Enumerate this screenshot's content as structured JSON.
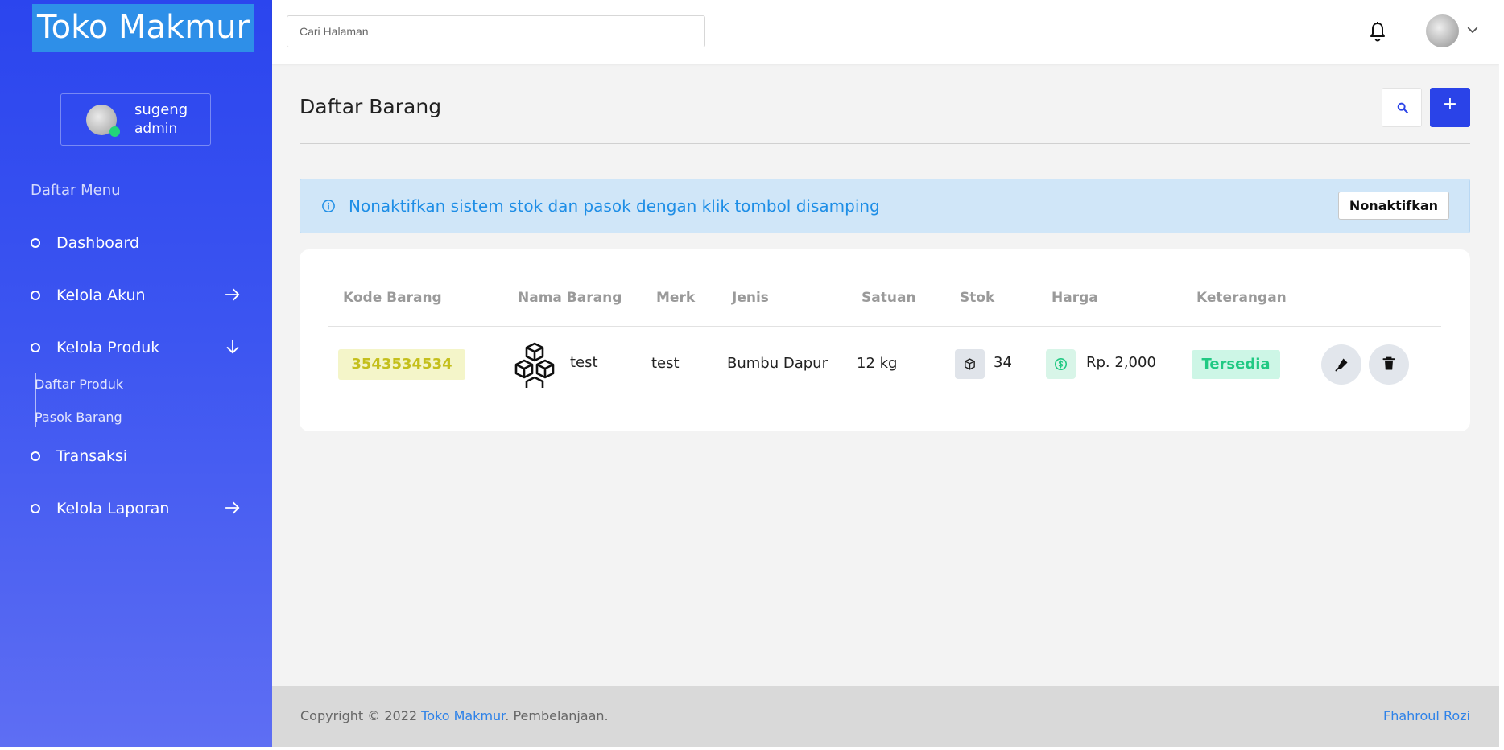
{
  "sidebar": {
    "brand": "Toko Makmur",
    "user": {
      "name": "sugeng",
      "role": "admin"
    },
    "menu_heading": "Daftar Menu",
    "items": [
      {
        "label": "Dashboard",
        "icon": "circle-icon"
      },
      {
        "label": "Kelola Akun",
        "icon": "arrow-right-icon"
      },
      {
        "label": "Kelola Produk",
        "icon": "arrow-down-icon"
      },
      {
        "label": "Transaksi",
        "icon": "circle-icon"
      },
      {
        "label": "Kelola Laporan",
        "icon": "arrow-right-icon"
      }
    ],
    "subitems": [
      {
        "label": "Daftar Produk"
      },
      {
        "label": "Pasok Barang"
      }
    ]
  },
  "header": {
    "search_placeholder": "Cari Halaman"
  },
  "main": {
    "title": "Daftar Barang",
    "add_label": "+",
    "alert": {
      "text": "Nonaktifkan sistem stok dan pasok dengan klik tombol disamping",
      "button": "Nonaktifkan"
    },
    "table": {
      "columns": [
        "Kode Barang",
        "Nama Barang",
        "Merk",
        "Jenis",
        "Satuan",
        "Stok",
        "Harga",
        "Keterangan"
      ],
      "rows": [
        {
          "kode": "3543534534",
          "nama": "test",
          "merk": "test",
          "jenis": "Bumbu Dapur",
          "satuan": "12 kg",
          "stok": "34",
          "harga": "Rp. 2,000",
          "keterangan": "Tersedia"
        }
      ]
    }
  },
  "footer": {
    "copyright": "Copyright © 2022 ",
    "brand": "Toko Makmur",
    "suffix": ". Pembelanjaan.",
    "author": "Fhahroul Rozi"
  },
  "colors": {
    "sidebar_top": "#2b45ee",
    "sidebar_bottom": "#5e6ef3",
    "primary": "#2a43e8",
    "link": "#2e82e8",
    "success": "#21c983",
    "code_yellow": "#c4bf1c",
    "alert_bg": "#d0e6f8"
  }
}
